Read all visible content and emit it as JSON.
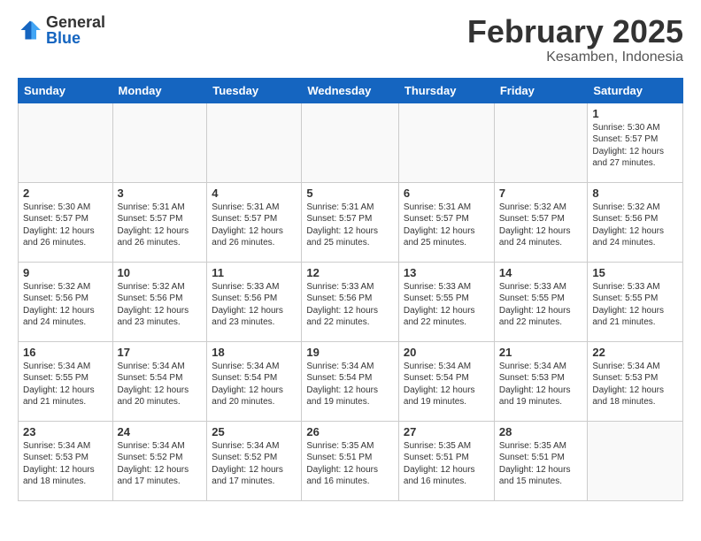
{
  "header": {
    "logo_general": "General",
    "logo_blue": "Blue",
    "month_title": "February 2025",
    "location": "Kesamben, Indonesia"
  },
  "days_of_week": [
    "Sunday",
    "Monday",
    "Tuesday",
    "Wednesday",
    "Thursday",
    "Friday",
    "Saturday"
  ],
  "weeks": [
    [
      {
        "num": "",
        "info": "",
        "empty": true
      },
      {
        "num": "",
        "info": "",
        "empty": true
      },
      {
        "num": "",
        "info": "",
        "empty": true
      },
      {
        "num": "",
        "info": "",
        "empty": true
      },
      {
        "num": "",
        "info": "",
        "empty": true
      },
      {
        "num": "",
        "info": "",
        "empty": true
      },
      {
        "num": "1",
        "info": "Sunrise: 5:30 AM\nSunset: 5:57 PM\nDaylight: 12 hours\nand 27 minutes."
      }
    ],
    [
      {
        "num": "2",
        "info": "Sunrise: 5:30 AM\nSunset: 5:57 PM\nDaylight: 12 hours\nand 26 minutes."
      },
      {
        "num": "3",
        "info": "Sunrise: 5:31 AM\nSunset: 5:57 PM\nDaylight: 12 hours\nand 26 minutes."
      },
      {
        "num": "4",
        "info": "Sunrise: 5:31 AM\nSunset: 5:57 PM\nDaylight: 12 hours\nand 26 minutes."
      },
      {
        "num": "5",
        "info": "Sunrise: 5:31 AM\nSunset: 5:57 PM\nDaylight: 12 hours\nand 25 minutes."
      },
      {
        "num": "6",
        "info": "Sunrise: 5:31 AM\nSunset: 5:57 PM\nDaylight: 12 hours\nand 25 minutes."
      },
      {
        "num": "7",
        "info": "Sunrise: 5:32 AM\nSunset: 5:57 PM\nDaylight: 12 hours\nand 24 minutes."
      },
      {
        "num": "8",
        "info": "Sunrise: 5:32 AM\nSunset: 5:56 PM\nDaylight: 12 hours\nand 24 minutes."
      }
    ],
    [
      {
        "num": "9",
        "info": "Sunrise: 5:32 AM\nSunset: 5:56 PM\nDaylight: 12 hours\nand 24 minutes."
      },
      {
        "num": "10",
        "info": "Sunrise: 5:32 AM\nSunset: 5:56 PM\nDaylight: 12 hours\nand 23 minutes."
      },
      {
        "num": "11",
        "info": "Sunrise: 5:33 AM\nSunset: 5:56 PM\nDaylight: 12 hours\nand 23 minutes."
      },
      {
        "num": "12",
        "info": "Sunrise: 5:33 AM\nSunset: 5:56 PM\nDaylight: 12 hours\nand 22 minutes."
      },
      {
        "num": "13",
        "info": "Sunrise: 5:33 AM\nSunset: 5:55 PM\nDaylight: 12 hours\nand 22 minutes."
      },
      {
        "num": "14",
        "info": "Sunrise: 5:33 AM\nSunset: 5:55 PM\nDaylight: 12 hours\nand 22 minutes."
      },
      {
        "num": "15",
        "info": "Sunrise: 5:33 AM\nSunset: 5:55 PM\nDaylight: 12 hours\nand 21 minutes."
      }
    ],
    [
      {
        "num": "16",
        "info": "Sunrise: 5:34 AM\nSunset: 5:55 PM\nDaylight: 12 hours\nand 21 minutes."
      },
      {
        "num": "17",
        "info": "Sunrise: 5:34 AM\nSunset: 5:54 PM\nDaylight: 12 hours\nand 20 minutes."
      },
      {
        "num": "18",
        "info": "Sunrise: 5:34 AM\nSunset: 5:54 PM\nDaylight: 12 hours\nand 20 minutes."
      },
      {
        "num": "19",
        "info": "Sunrise: 5:34 AM\nSunset: 5:54 PM\nDaylight: 12 hours\nand 19 minutes."
      },
      {
        "num": "20",
        "info": "Sunrise: 5:34 AM\nSunset: 5:54 PM\nDaylight: 12 hours\nand 19 minutes."
      },
      {
        "num": "21",
        "info": "Sunrise: 5:34 AM\nSunset: 5:53 PM\nDaylight: 12 hours\nand 19 minutes."
      },
      {
        "num": "22",
        "info": "Sunrise: 5:34 AM\nSunset: 5:53 PM\nDaylight: 12 hours\nand 18 minutes."
      }
    ],
    [
      {
        "num": "23",
        "info": "Sunrise: 5:34 AM\nSunset: 5:53 PM\nDaylight: 12 hours\nand 18 minutes."
      },
      {
        "num": "24",
        "info": "Sunrise: 5:34 AM\nSunset: 5:52 PM\nDaylight: 12 hours\nand 17 minutes."
      },
      {
        "num": "25",
        "info": "Sunrise: 5:34 AM\nSunset: 5:52 PM\nDaylight: 12 hours\nand 17 minutes."
      },
      {
        "num": "26",
        "info": "Sunrise: 5:35 AM\nSunset: 5:51 PM\nDaylight: 12 hours\nand 16 minutes."
      },
      {
        "num": "27",
        "info": "Sunrise: 5:35 AM\nSunset: 5:51 PM\nDaylight: 12 hours\nand 16 minutes."
      },
      {
        "num": "28",
        "info": "Sunrise: 5:35 AM\nSunset: 5:51 PM\nDaylight: 12 hours\nand 15 minutes."
      },
      {
        "num": "",
        "info": "",
        "empty": true
      }
    ]
  ]
}
